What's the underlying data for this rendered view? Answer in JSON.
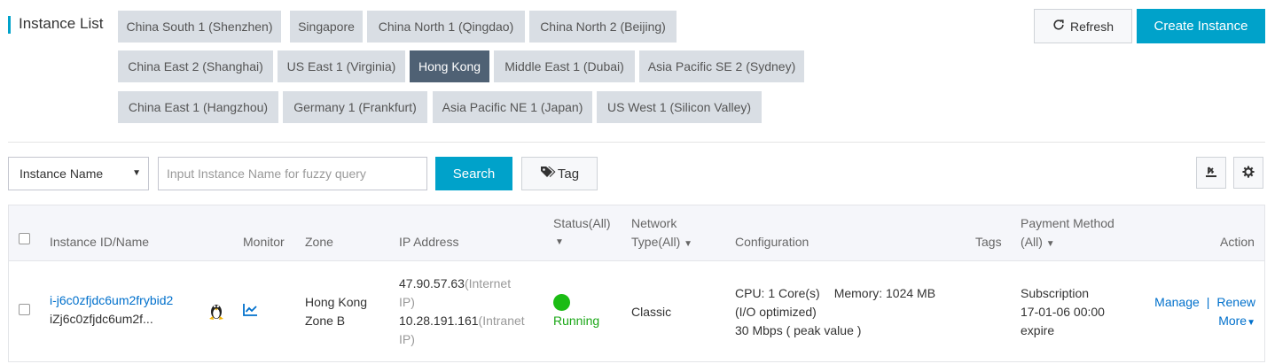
{
  "header": {
    "title": "Instance List",
    "refresh_label": "Refresh",
    "create_label": "Create Instance"
  },
  "regions": [
    {
      "label": "China South 1 (Shenzhen)",
      "active": false
    },
    {
      "label": "Singapore",
      "active": false
    },
    {
      "label": "China North 1 (Qingdao)",
      "active": false
    },
    {
      "label": "China North 2 (Beijing)",
      "active": false
    },
    {
      "label": "China East 2 (Shanghai)",
      "active": false
    },
    {
      "label": "US East 1 (Virginia)",
      "active": false
    },
    {
      "label": "Hong Kong",
      "active": true
    },
    {
      "label": "Middle East 1 (Dubai)",
      "active": false
    },
    {
      "label": "Asia Pacific SE 2 (Sydney)",
      "active": false
    },
    {
      "label": "China East 1 (Hangzhou)",
      "active": false
    },
    {
      "label": "Germany 1 (Frankfurt)",
      "active": false
    },
    {
      "label": "Asia Pacific NE 1 (Japan)",
      "active": false
    },
    {
      "label": "US West 1 (Silicon Valley)",
      "active": false
    }
  ],
  "toolbar": {
    "filter_selected": "Instance Name",
    "search_placeholder": "Input Instance Name for fuzzy query",
    "search_label": "Search",
    "tag_label": "Tag"
  },
  "table": {
    "headers": {
      "instance": "Instance ID/Name",
      "monitor": "Monitor",
      "zone": "Zone",
      "ip": "IP Address",
      "status_line1": "Status(All)",
      "network_line1": "Network",
      "network_line2": "Type(All)",
      "config": "Configuration",
      "tags": "Tags",
      "payment_line1": "Payment Method",
      "payment_line2": "(All)",
      "action": "Action"
    },
    "rows": [
      {
        "instance_id": "i-j6c0zfjdc6um2frybid2",
        "instance_name": "iZj6c0zfjdc6um2f...",
        "zone_line1": "Hong Kong",
        "zone_line2": "Zone B",
        "ip_public": "47.90.57.63",
        "ip_public_note": "(Internet",
        "ip_public_note2": "IP)",
        "ip_private": "10.28.191.161",
        "ip_private_note": "(Intranet",
        "ip_private_note2": "IP)",
        "status": "Running",
        "network_type": "Classic",
        "config_cpu": "CPU: 1 Core(s)",
        "config_memory": "Memory: 1024 MB",
        "config_io": "(I/O optimized)",
        "config_bandwidth": "30 Mbps ( peak value )",
        "payment_line1": "Subscription",
        "payment_line2": "17-01-06 00:00",
        "payment_line3": "expire",
        "action_manage": "Manage",
        "action_renew": "Renew",
        "action_more": "More"
      }
    ]
  },
  "colors": {
    "accent": "#00a2ca",
    "active_tab": "#4f6174",
    "link": "#0070cc",
    "running": "#1bbc14"
  }
}
